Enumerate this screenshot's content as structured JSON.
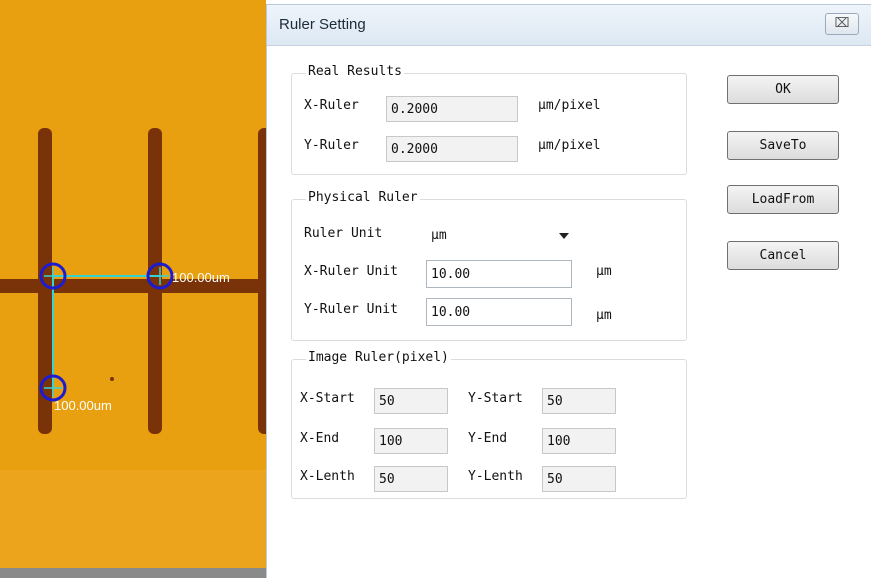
{
  "image_view": {
    "measure_horizontal": "100.00um",
    "measure_vertical": "100.00um"
  },
  "dialog": {
    "title": "Ruler Setting",
    "close_icon": "close-icon",
    "real_results": {
      "legend": "Real Results",
      "x_label": "X-Ruler",
      "x_value": "0.2000",
      "x_unit": "µm/pixel",
      "y_label": "Y-Ruler",
      "y_value": "0.2000",
      "y_unit": "µm/pixel"
    },
    "physical_ruler": {
      "legend": "Physical Ruler",
      "unit_label": "Ruler Unit",
      "unit_value": "µm",
      "x_label": "X-Ruler Unit",
      "x_value": "10.00",
      "x_unit": "µm",
      "y_label": "Y-Ruler Unit",
      "y_value": "10.00",
      "y_unit": "µm"
    },
    "image_ruler": {
      "legend": "Image Ruler(pixel)",
      "x_start_label": "X-Start",
      "x_start": "50",
      "y_start_label": "Y-Start",
      "y_start": "50",
      "x_end_label": "X-End",
      "x_end": "100",
      "y_end_label": "Y-End",
      "y_end": "100",
      "x_length_label": "X-Lenth",
      "x_length": "50",
      "y_length_label": "Y-Lenth",
      "y_length": "50"
    },
    "buttons": {
      "ok": "OK",
      "save_to": "SaveTo",
      "load_from": "LoadFrom",
      "cancel": "Cancel"
    }
  },
  "colors": {
    "image_background": "#e8a010",
    "trace": "#7a3208",
    "measure_line": "#35d4d4",
    "marker": "#1c1cd0"
  }
}
